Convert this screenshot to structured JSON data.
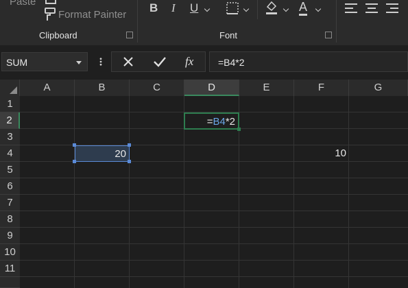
{
  "ribbon": {
    "paste_label": "Paste",
    "format_painter_label": "Format Painter",
    "clipboard_group": "Clipboard",
    "font_group": "Font",
    "bold_label": "B",
    "italic_label": "I",
    "underline_label": "U",
    "font_color_label": "A"
  },
  "formula_bar": {
    "name_box": "SUM",
    "formula": "=B4*2",
    "fx_label": "fx"
  },
  "columns": [
    "A",
    "B",
    "C",
    "D",
    "E",
    "F",
    "G"
  ],
  "rows": [
    "1",
    "2",
    "3",
    "4",
    "5",
    "6",
    "7",
    "8",
    "9",
    "10",
    "11"
  ],
  "cells": {
    "D2": {
      "prefix": "=",
      "ref": "B4",
      "suffix": "*2"
    },
    "B4": "20",
    "F4": "10"
  },
  "colors": {
    "background": "#1e1e1e",
    "ribbon": "#2b2b2b",
    "active_cell_border": "#2e7d4f",
    "reference_highlight": "#5b8bd8"
  }
}
